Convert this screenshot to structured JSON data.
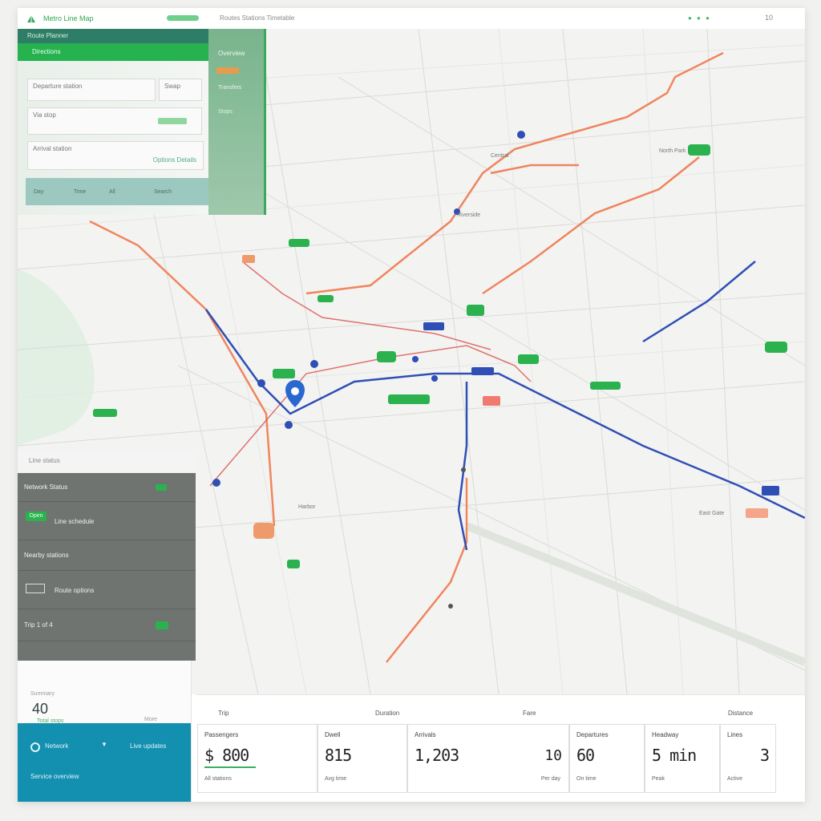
{
  "header": {
    "app_title": "Metro Line Map",
    "nav_text": "Routes  Stations  Timetable",
    "status_dots": "● ● ●",
    "user_label": "10"
  },
  "top_panel": {
    "header_label": "Route Planner",
    "tab_label": "Directions",
    "from_placeholder": "Departure station",
    "from_button": "Swap",
    "via_value": "Via stop",
    "to_value": "Arrival station",
    "to_hint": "Options  Details",
    "footer_items": [
      "Day",
      "Time",
      "All",
      "Search"
    ],
    "side_title": "Overview",
    "side_line1": "Transfers",
    "side_line2": "Stops"
  },
  "map_labels": {
    "station_a": "Central",
    "station_b": "Riverside",
    "station_c": "North Park",
    "station_d": "East Gate",
    "station_e": "Harbor"
  },
  "left_panel": {
    "top_label": "Line status",
    "rows": [
      {
        "label": "Network Status",
        "badge": ""
      },
      {
        "label": "Line schedule",
        "badge": "Open"
      },
      {
        "label": "Nearby stations",
        "badge": ""
      },
      {
        "label": "Route options",
        "badge": ""
      },
      {
        "label": "Trip 1 of 4",
        "badge": ""
      }
    ]
  },
  "bottom_left": {
    "small_label": "Summary",
    "big_value": "40",
    "sub_label": "Total stops",
    "link": "More",
    "teal_title": "Network",
    "teal_sub": "Live updates",
    "teal_footer": "Service overview"
  },
  "stats": {
    "labels": [
      "Trip",
      "Duration",
      "Fare",
      "Distance"
    ],
    "cards": [
      {
        "title": "Passengers",
        "value": "$ 800",
        "sub": "All stations"
      },
      {
        "title": "Dwell",
        "value": "815",
        "sub": "Avg time"
      },
      {
        "title": "Arrivals",
        "value": "1,203",
        "right": "10",
        "sub": "Per day"
      },
      {
        "title": "Departures",
        "value": "60",
        "sub": "On time"
      },
      {
        "title": "Headway",
        "value": "5 min",
        "sub": "Peak"
      },
      {
        "title": "Lines",
        "value": "3",
        "sub": "Active"
      }
    ]
  },
  "colors": {
    "accent_green": "#2bb24f",
    "orange_line": "#ef7a4e",
    "blue_line": "#2f4fb5",
    "teal": "#138fb0"
  }
}
